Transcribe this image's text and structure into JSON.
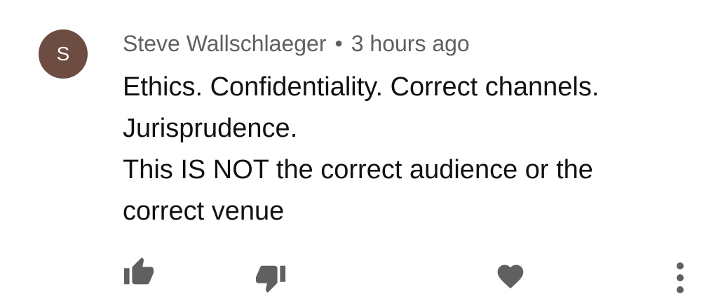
{
  "comment": {
    "avatar_letter": "S",
    "avatar_color": "#6d4c41",
    "author": "Steve Wallschlaeger",
    "separator": "•",
    "timestamp": "3 hours ago",
    "lines": [
      "Ethics. Confidentiality. Correct channels.",
      "Jurisprudence.",
      "This IS NOT the correct audience or the",
      "correct venue"
    ]
  },
  "actions": {
    "icons": [
      "thumb-up-icon",
      "thumb-down-icon",
      "heart-icon",
      "more-vert-icon"
    ],
    "icon_color": "#606060"
  }
}
